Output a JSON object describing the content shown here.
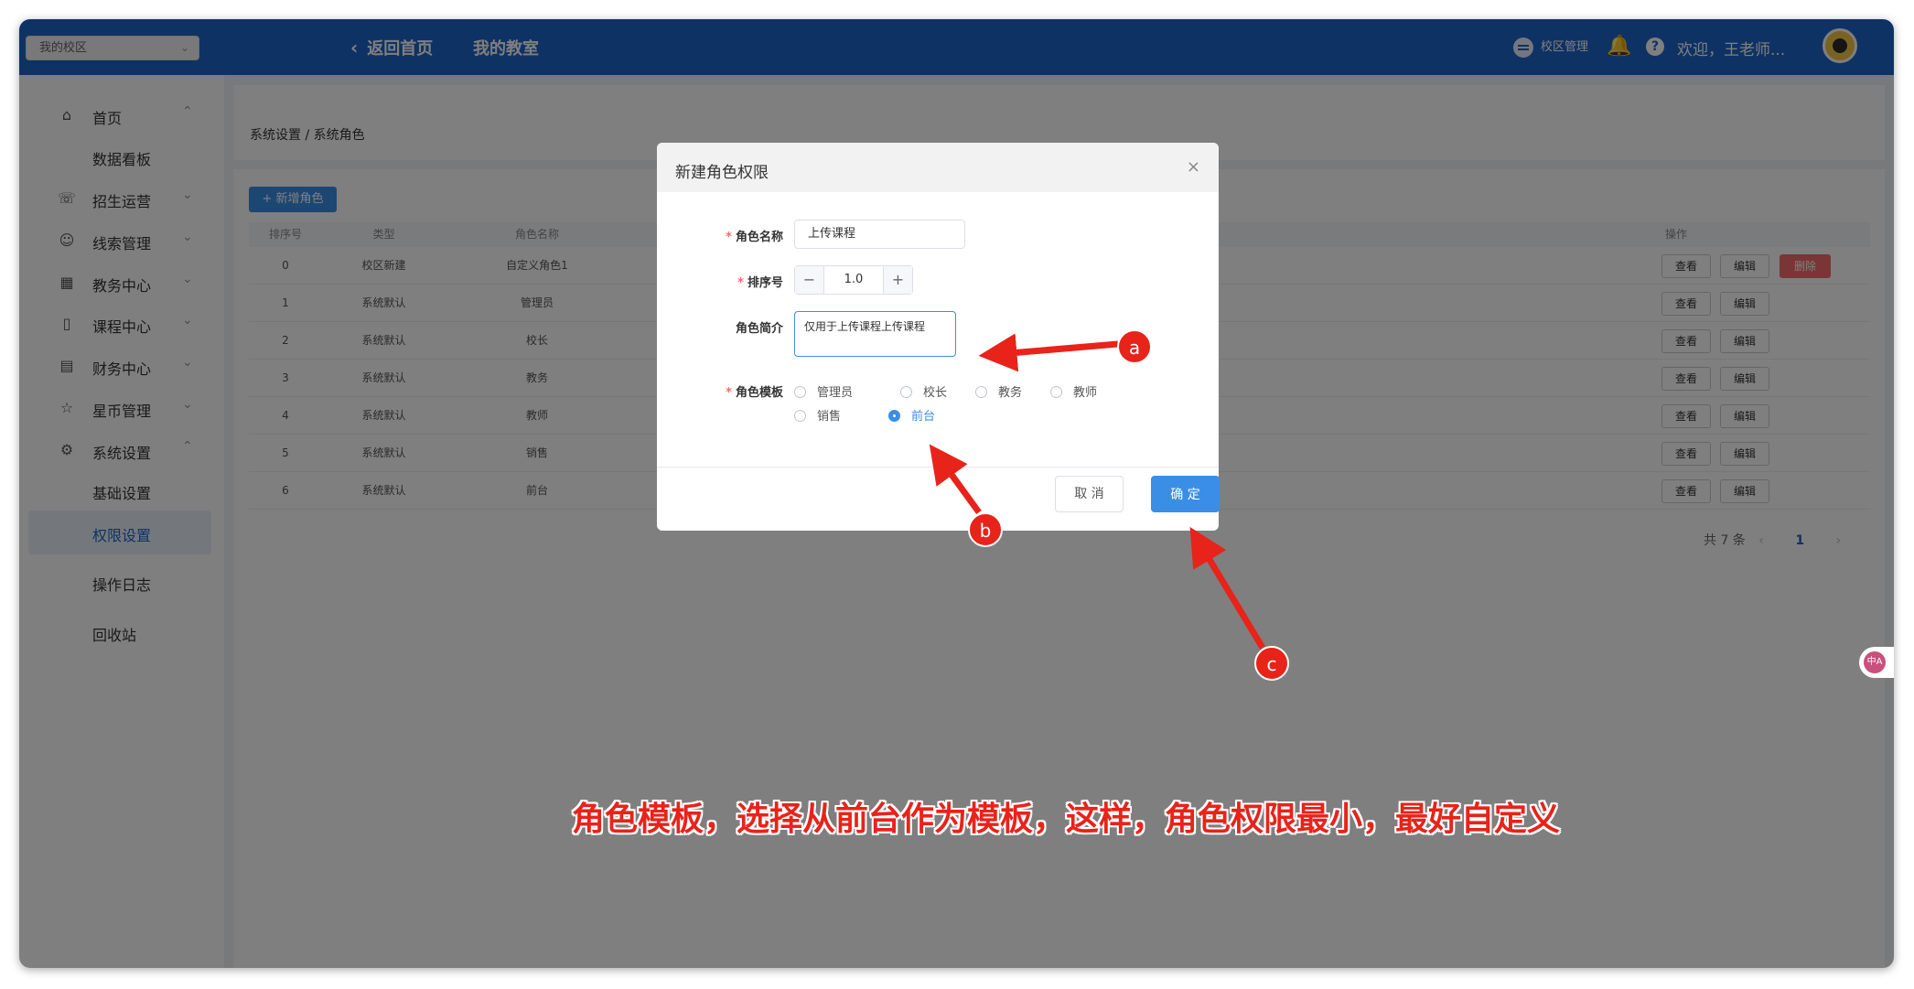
{
  "topbar": {
    "campus_select": "我的校区",
    "back_home": "返回首页",
    "my_classroom": "我的教室",
    "campus_management": "校区管理",
    "welcome": "欢迎，王老师..."
  },
  "sidebar": {
    "items": [
      {
        "label": "首页",
        "icon": "home-icon"
      },
      {
        "label": "数据看板"
      },
      {
        "label": "招生运营",
        "icon": "phone-icon"
      },
      {
        "label": "线索管理",
        "icon": "user-icon"
      },
      {
        "label": "教务中心",
        "icon": "building-icon"
      },
      {
        "label": "课程中心",
        "icon": "book-icon"
      },
      {
        "label": "财务中心",
        "icon": "card-icon"
      },
      {
        "label": "星币管理",
        "icon": "star-icon"
      },
      {
        "label": "系统设置",
        "icon": "gear-icon"
      },
      {
        "label": "基础设置"
      },
      {
        "label": "权限设置"
      },
      {
        "label": "操作日志"
      },
      {
        "label": "回收站"
      }
    ]
  },
  "breadcrumb": "系统设置 / 系统角色",
  "add_role_button": "+ 新增角色",
  "table": {
    "headers": {
      "index": "排序号",
      "type": "类型",
      "name": "角色名称",
      "actions": "操作"
    },
    "rows": [
      {
        "index": "0",
        "type": "校区新建",
        "name": "自定义角色1"
      },
      {
        "index": "1",
        "type": "系统默认",
        "name": "管理员"
      },
      {
        "index": "2",
        "type": "系统默认",
        "name": "校长"
      },
      {
        "index": "3",
        "type": "系统默认",
        "name": "教务"
      },
      {
        "index": "4",
        "type": "系统默认",
        "name": "教师"
      },
      {
        "index": "5",
        "type": "系统默认",
        "name": "销售"
      },
      {
        "index": "6",
        "type": "系统默认",
        "name": "前台"
      }
    ],
    "view_label": "查看",
    "edit_label": "编辑",
    "delete_label": "删除"
  },
  "pager": {
    "total": "共 7 条",
    "current": "1"
  },
  "dialog": {
    "title": "新建角色权限",
    "role_name_label": "角色名称",
    "role_name_value": "上传课程",
    "order_label": "排序号",
    "order_value": "1.0",
    "intro_label": "角色简介",
    "intro_value": "仅用于上传课程上传课程",
    "template_label": "角色模板",
    "templates": [
      "管理员",
      "校长",
      "教务",
      "教师",
      "销售",
      "前台"
    ],
    "selected_template": "前台",
    "cancel": "取 消",
    "ok": "确 定"
  },
  "annotations": {
    "a": "a",
    "b": "b",
    "c": "c",
    "caption": "角色模板，选择从前台作为模板，这样，角色权限最小，最好自定义",
    "color": "#e8231a"
  },
  "float_button": "中A"
}
